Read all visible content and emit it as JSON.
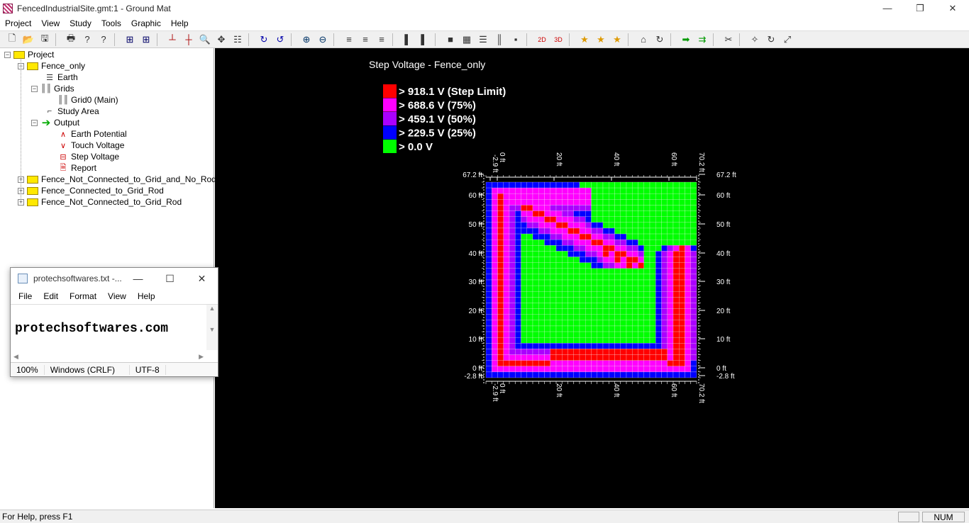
{
  "window": {
    "title": "FencedIndustrialSite.gmt:1 - Ground Mat",
    "min": "—",
    "max": "❐",
    "close": "✕"
  },
  "menu": [
    "Project",
    "View",
    "Study",
    "Tools",
    "Graphic",
    "Help"
  ],
  "toolbar_icons": [
    "new-icon",
    "open-icon",
    "save-icon",
    "sep",
    "print-icon",
    "help-icon",
    "context-help-icon",
    "sep",
    "grid-icon",
    "grid2-icon",
    "sep",
    "axis-icon",
    "axis2-icon",
    "zoom-window-icon",
    "pan-icon",
    "fit-icon",
    "sep",
    "rotate-icon",
    "rotate2-icon",
    "sep",
    "zoom-in-icon",
    "zoom-out-icon",
    "sep",
    "layout1-icon",
    "layout2-icon",
    "layout3-icon",
    "sep",
    "bar-icon",
    "bar2-icon",
    "sep",
    "box-icon",
    "grid3-icon",
    "list-icon",
    "columns-icon",
    "square-icon",
    "sep",
    "2d-icon",
    "3d-icon",
    "sep",
    "star-icon",
    "star-x-icon",
    "star-move-icon",
    "sep",
    "building-icon",
    "refresh-icon",
    "sep",
    "arrow-right-icon",
    "arrows-right-icon",
    "sep",
    "cut-icon",
    "sep",
    "wand-icon",
    "rotate3-icon",
    "resize-icon"
  ],
  "tree": [
    {
      "label": "Project",
      "x": 6,
      "y": 77,
      "icon": "folder",
      "exp": "−"
    },
    {
      "label": "Fence_only",
      "x": 25,
      "y": 93,
      "icon": "folder",
      "exp": "−"
    },
    {
      "label": "Earth",
      "x": 62,
      "y": 109,
      "icon": "earth"
    },
    {
      "label": "Grids",
      "x": 44,
      "y": 125,
      "icon": "grids",
      "exp": "−"
    },
    {
      "label": "Grid0 (Main)",
      "x": 81,
      "y": 141,
      "icon": "grid"
    },
    {
      "label": "Study Area",
      "x": 62,
      "y": 157,
      "icon": "area"
    },
    {
      "label": "Output",
      "x": 44,
      "y": 173,
      "icon": "output",
      "exp": "−"
    },
    {
      "label": "Earth Potential",
      "x": 81,
      "y": 189,
      "icon": "potential"
    },
    {
      "label": "Touch Voltage",
      "x": 81,
      "y": 205,
      "icon": "touch"
    },
    {
      "label": "Step Voltage",
      "x": 81,
      "y": 221,
      "icon": "step"
    },
    {
      "label": "Report",
      "x": 81,
      "y": 237,
      "icon": "report"
    },
    {
      "label": "Fence_Not_Connected_to_Grid_and_No_Rods",
      "x": 25,
      "y": 253,
      "icon": "folder",
      "exp": "+"
    },
    {
      "label": "Fence_Connected_to_Grid_Rod",
      "x": 25,
      "y": 269,
      "icon": "folder",
      "exp": "+"
    },
    {
      "label": "Fence_Not_Connected_to_Grid_Rod",
      "x": 25,
      "y": 285,
      "icon": "folder",
      "exp": "+"
    }
  ],
  "plot": {
    "title": "Step Voltage - Fence_only",
    "legend": [
      {
        "label": "> 918.1 V (Step Limit)",
        "color": "#ff0000"
      },
      {
        "label": "> 688.6 V (75%)",
        "color": "#ff00ff"
      },
      {
        "label": "> 459.1 V (50%)",
        "color": "#aa00ff"
      },
      {
        "label": "> 229.5 V (25%)",
        "color": "#0000ff"
      },
      {
        "label": "> 0.0 V",
        "color": "#00ff00"
      }
    ],
    "x_ticks": [
      "-2.9 ft",
      "0 ft",
      "20 ft",
      "40 ft",
      "60 ft",
      "70.2 ft"
    ],
    "y_ticks": [
      "67.2 ft",
      "60 ft",
      "50 ft",
      "40 ft",
      "30 ft",
      "20 ft",
      "10 ft",
      "0 ft",
      "-2.8 ft"
    ]
  },
  "notepad": {
    "title": "protechsoftwares.txt -...",
    "menu": [
      "File",
      "Edit",
      "Format",
      "View",
      "Help"
    ],
    "text": "protechsoftwares.com",
    "status": [
      "100%",
      "Windows (CRLF)",
      "UTF-8"
    ]
  },
  "status": {
    "help": "For Help, press F1",
    "num": "NUM"
  }
}
